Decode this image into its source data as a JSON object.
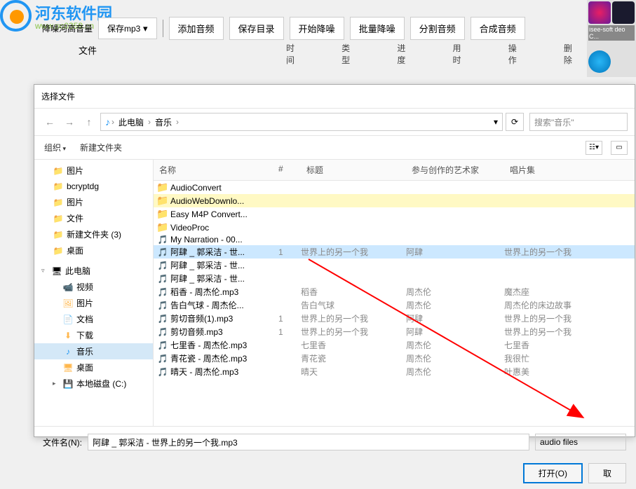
{
  "watermark": {
    "text": "河东软件园",
    "url": "www.pc0359.cn"
  },
  "toolbar": {
    "left_section": "降噪河高音量",
    "save_format": "保存mp3",
    "buttons": [
      "添加音频",
      "保存目录",
      "开始降噪",
      "批量降噪",
      "分割音频",
      "合成音频"
    ]
  },
  "columns": {
    "file": "文件",
    "headers": [
      "时间",
      "类型",
      "进度",
      "用时",
      "操作",
      "删除"
    ]
  },
  "dialog": {
    "title": "选择文件",
    "breadcrumb": {
      "this_pc": "此电脑",
      "music": "音乐",
      "dropdown": "▾",
      "refresh": "⟳",
      "search_placeholder": "搜索\"音乐\""
    },
    "organize": {
      "organize": "组织",
      "new_folder": "新建文件夹"
    },
    "tree": {
      "items": [
        {
          "icon": "folder",
          "label": "图片"
        },
        {
          "icon": "folder",
          "label": "bcryptdg"
        },
        {
          "icon": "folder",
          "label": "图片"
        },
        {
          "icon": "folder",
          "label": "文件"
        },
        {
          "icon": "folder",
          "label": "新建文件夹 (3)"
        },
        {
          "icon": "folder",
          "label": "桌面"
        }
      ],
      "section_pc": "此电脑",
      "pc_items": [
        {
          "icon": "video",
          "label": "视频"
        },
        {
          "icon": "image",
          "label": "图片"
        },
        {
          "icon": "doc",
          "label": "文档"
        },
        {
          "icon": "download",
          "label": "下载"
        },
        {
          "icon": "music",
          "label": "音乐",
          "active": true
        },
        {
          "icon": "desktop",
          "label": "桌面"
        },
        {
          "icon": "disk",
          "label": "本地磁盘 (C:)"
        }
      ]
    },
    "file_headers": {
      "name": "名称",
      "num": "#",
      "title": "标题",
      "artist": "参与创作的艺术家",
      "album": "唱片集"
    },
    "files": [
      {
        "type": "folder",
        "name": "AudioConvert",
        "num": "",
        "title": "",
        "artist": "",
        "album": ""
      },
      {
        "type": "folder",
        "name": "AudioWebDownlo...",
        "num": "",
        "title": "",
        "artist": "",
        "album": "",
        "highlighted": true
      },
      {
        "type": "folder",
        "name": "Easy M4P Convert...",
        "num": "",
        "title": "",
        "artist": "",
        "album": ""
      },
      {
        "type": "folder",
        "name": "VideoProc",
        "num": "",
        "title": "",
        "artist": "",
        "album": ""
      },
      {
        "type": "audio",
        "name": "My Narration - 00...",
        "num": "",
        "title": "",
        "artist": "",
        "album": ""
      },
      {
        "type": "audio",
        "name": "阿肆 _ 郭采洁 - 世...",
        "num": "1",
        "title": "世界上的另一个我",
        "artist": "阿肆",
        "album": "世界上的另一个我",
        "selected": true
      },
      {
        "type": "audio",
        "name": "阿肆 _ 郭采洁 - 世...",
        "num": "",
        "title": "",
        "artist": "",
        "album": ""
      },
      {
        "type": "audio",
        "name": "阿肆 _ 郭采洁 - 世...",
        "num": "",
        "title": "",
        "artist": "",
        "album": ""
      },
      {
        "type": "audio",
        "name": "稻香 - 周杰伦.mp3",
        "num": "",
        "title": "稻香",
        "artist": "周杰伦",
        "album": "魔杰座"
      },
      {
        "type": "audio",
        "name": "告白气球 - 周杰伦...",
        "num": "",
        "title": "告白气球",
        "artist": "周杰伦",
        "album": "周杰伦的床边故事"
      },
      {
        "type": "audio",
        "name": "剪切音频(1).mp3",
        "num": "1",
        "title": "世界上的另一个我",
        "artist": "阿肆",
        "album": "世界上的另一个我"
      },
      {
        "type": "audio",
        "name": "剪切音频.mp3",
        "num": "1",
        "title": "世界上的另一个我",
        "artist": "阿肆",
        "album": "世界上的另一个我"
      },
      {
        "type": "audio",
        "name": "七里香 - 周杰伦.mp3",
        "num": "",
        "title": "七里香",
        "artist": "周杰伦",
        "album": "七里香"
      },
      {
        "type": "audio",
        "name": "青花瓷 - 周杰伦.mp3",
        "num": "",
        "title": "青花瓷",
        "artist": "周杰伦",
        "album": "我很忙"
      },
      {
        "type": "audio",
        "name": "晴天 - 周杰伦.mp3",
        "num": "",
        "title": "晴天",
        "artist": "周杰伦",
        "album": "叶惠美"
      }
    ],
    "filename_label": "文件名(N):",
    "filename_value": "阿肆 _ 郭采洁 - 世界上的另一个我.mp3",
    "filter": "audio files",
    "open_btn": "打开(O)",
    "cancel_btn": "取"
  }
}
